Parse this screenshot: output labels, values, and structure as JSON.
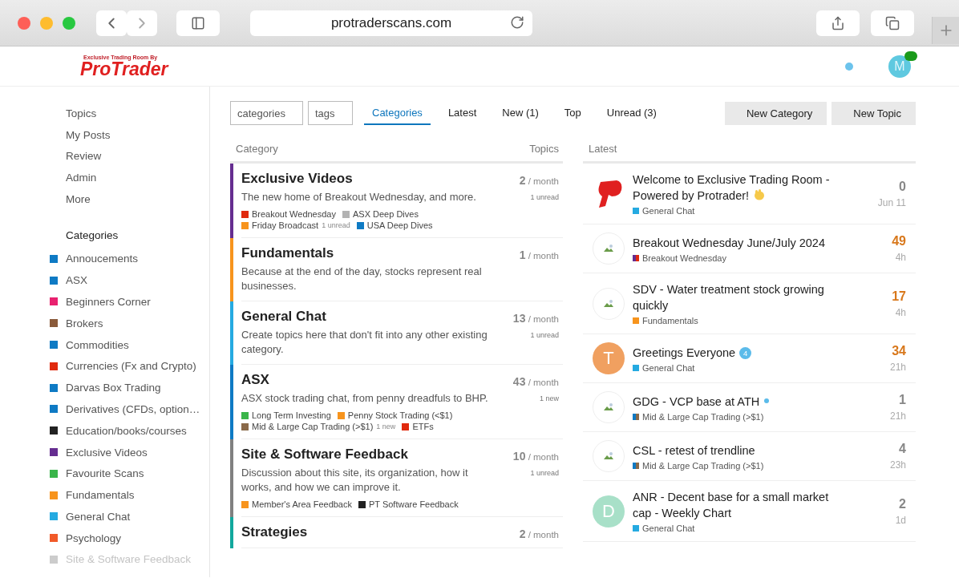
{
  "browser": {
    "url": "protraderscans.com"
  },
  "header": {
    "logo_tagline": "Exclusive Trading Room By",
    "logo_name": "ProTrader",
    "avatar_letter": "M",
    "notification_dot": true
  },
  "sidebar": {
    "items": [
      "Topics",
      "My Posts",
      "Review",
      "Admin",
      "More"
    ],
    "categories_heading": "Categories",
    "categories": [
      {
        "name": "Annoucements",
        "color": "#0e7ac4"
      },
      {
        "name": "ASX",
        "color": "#0e7ac4"
      },
      {
        "name": "Beginners Corner",
        "color": "#e8216f"
      },
      {
        "name": "Brokers",
        "color": "#8a5a3a"
      },
      {
        "name": "Commodities",
        "color": "#0e7ac4"
      },
      {
        "name": "Currencies (Fx and Crypto)",
        "color": "#e02a0e"
      },
      {
        "name": "Darvas Box Trading",
        "color": "#0e7ac4"
      },
      {
        "name": "Derivatives (CFDs, option…",
        "color": "#0e7ac4"
      },
      {
        "name": "Education/books/courses",
        "color": "#222222"
      },
      {
        "name": "Exclusive Videos",
        "color": "#652d90"
      },
      {
        "name": "Favourite Scans",
        "color": "#3ab54a"
      },
      {
        "name": "Fundamentals",
        "color": "#f7941d"
      },
      {
        "name": "General Chat",
        "color": "#25aae1"
      },
      {
        "name": "Psychology",
        "color": "#f15a29"
      },
      {
        "name": "Site & Software Feedback",
        "color": "#cccccc",
        "faded": true
      }
    ]
  },
  "filters": [
    {
      "placeholder": "categories"
    },
    {
      "placeholder": "tags"
    }
  ],
  "tabs": [
    {
      "label": "Categories",
      "selected": true
    },
    {
      "label": "Latest",
      "selected": false
    },
    {
      "label": "New (1)",
      "selected": false
    },
    {
      "label": "Top",
      "selected": false
    },
    {
      "label": "Unread (3)",
      "selected": false
    }
  ],
  "buttons": [
    "New Category",
    "New Topic"
  ],
  "categories_table": {
    "columns": [
      "Category",
      "Topics"
    ],
    "rows": [
      {
        "name": "Exclusive Videos",
        "color": "#652d90",
        "count": "2",
        "period": "/ month",
        "note": "1 unread",
        "description": "The new home of Breakout Wednesday, and more.",
        "subcategories": [
          {
            "name": "Breakout Wednesday",
            "color": "#e02a0e"
          },
          {
            "name": "ASX Deep Dives",
            "color": "#b3b3b3"
          },
          {
            "name": "Friday Broadcast",
            "color": "#f7941d",
            "note": "1 unread"
          },
          {
            "name": "USA Deep Dives",
            "color": "#0e7ac4"
          }
        ]
      },
      {
        "name": "Fundamentals",
        "color": "#f7941d",
        "count": "1",
        "period": "/ month",
        "description": "Because at the end of the day, stocks represent real businesses."
      },
      {
        "name": "General Chat",
        "color": "#25aae1",
        "count": "13",
        "period": "/ month",
        "note": "1 unread",
        "description": "Create topics here that don't fit into any other existing category."
      },
      {
        "name": "ASX",
        "color": "#0e7ac4",
        "count": "43",
        "period": "/ month",
        "note": "1 new",
        "description": "ASX stock trading chat, from penny dreadfuls to BHP.",
        "subcategories": [
          {
            "name": "Long Term Investing",
            "color": "#3ab54a"
          },
          {
            "name": "Penny Stock Trading (<$1)",
            "color": "#f7941d"
          },
          {
            "name": "Mid & Large Cap Trading (>$1)",
            "color": "#8a6a4a",
            "note": "1 new"
          },
          {
            "name": "ETFs",
            "color": "#e02a0e"
          }
        ]
      },
      {
        "name": "Site & Software Feedback",
        "color": "#808080",
        "count": "10",
        "period": "/ month",
        "note": "1 unread",
        "description": "Discussion about this site, its organization, how it works, and how we can improve it.",
        "subcategories": [
          {
            "name": "Member's Area Feedback",
            "color": "#f7941d"
          },
          {
            "name": "PT Software Feedback",
            "color": "#222222"
          }
        ]
      },
      {
        "name": "Strategies",
        "color": "#12a89d",
        "count": "2",
        "period": "/ month"
      }
    ]
  },
  "latest": {
    "heading": "Latest",
    "topics": [
      {
        "title": "Welcome to Exclusive Trading Room - Powered by Protrader!",
        "emoji": true,
        "avatar": {
          "kind": "logo"
        },
        "category": {
          "name": "General Chat",
          "color": "#25aae1"
        },
        "count": "0",
        "hot": false,
        "age": "Jun 11"
      },
      {
        "title": "Breakout Wednesday June/July 2024",
        "avatar": {
          "kind": "broken"
        },
        "category": {
          "name": "Breakout Wednesday",
          "color": "#e02a0e",
          "parent": {
            "color": "#652d90"
          }
        },
        "count": "49",
        "hot": true,
        "age": "4h"
      },
      {
        "title": "SDV - Water treatment stock growing quickly",
        "avatar": {
          "kind": "broken"
        },
        "category": {
          "name": "Fundamentals",
          "color": "#f7941d"
        },
        "count": "17",
        "hot": true,
        "age": "4h"
      },
      {
        "title": "Greetings Everyone",
        "badge": "4",
        "avatar": {
          "kind": "letter",
          "letter": "T",
          "color": "#f0a060"
        },
        "category": {
          "name": "General Chat",
          "color": "#25aae1"
        },
        "count": "34",
        "hot": true,
        "age": "21h"
      },
      {
        "title": "GDG - VCP base at ATH",
        "unread_dot": true,
        "avatar": {
          "kind": "broken"
        },
        "category": {
          "name": "Mid & Large Cap Trading (>$1)",
          "color": "#8a6a4a",
          "parent": {
            "color": "#0e7ac4"
          }
        },
        "count": "1",
        "hot": false,
        "age": "21h"
      },
      {
        "title": "CSL - retest of trendline",
        "avatar": {
          "kind": "broken"
        },
        "category": {
          "name": "Mid & Large Cap Trading (>$1)",
          "color": "#8a6a4a",
          "parent": {
            "color": "#0e7ac4"
          }
        },
        "count": "4",
        "hot": false,
        "age": "23h"
      },
      {
        "title": "ANR - Decent base for a small market cap - Weekly Chart",
        "avatar": {
          "kind": "letter",
          "letter": "D",
          "color": "#a8e0c8"
        },
        "category": {
          "name": "General Chat",
          "color": "#25aae1"
        },
        "count": "2",
        "hot": false,
        "age": "1d"
      }
    ]
  }
}
